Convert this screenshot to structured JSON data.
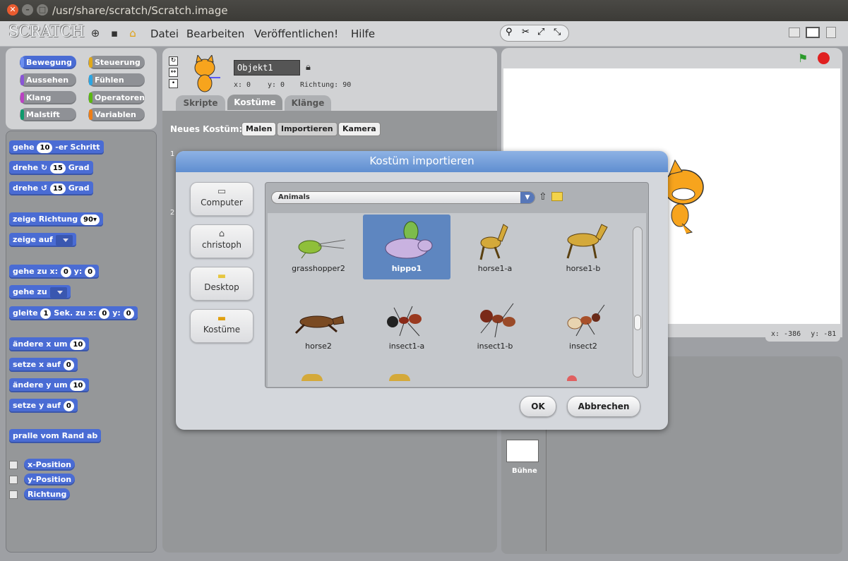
{
  "window": {
    "title": "/usr/share/scratch/Scratch.image"
  },
  "menu": {
    "logo": "SCRATCH",
    "items": [
      "Datei",
      "Bearbeiten",
      "Veröffentlichen!",
      "Hilfe"
    ]
  },
  "categories": [
    {
      "label": "Bewegung",
      "color": "#4a6cd4"
    },
    {
      "label": "Steuerung",
      "color": "#e1a91a"
    },
    {
      "label": "Aussehen",
      "color": "#8a55d7"
    },
    {
      "label": "Fühlen",
      "color": "#2ca5e2"
    },
    {
      "label": "Klang",
      "color": "#bb42c3"
    },
    {
      "label": "Operatoren",
      "color": "#5cb712"
    },
    {
      "label": "Malstift",
      "color": "#0e9a6c"
    },
    {
      "label": "Variablen",
      "color": "#ee7d16"
    }
  ],
  "blocks": {
    "move": {
      "a": "gehe",
      "v": "10",
      "b": "-er Schritt"
    },
    "turn_right": {
      "a": "drehe",
      "v": "15",
      "b": "Grad"
    },
    "turn_left": {
      "a": "drehe",
      "v": "15",
      "b": "Grad"
    },
    "point_dir": {
      "a": "zeige Richtung",
      "v": "90"
    },
    "point_to": {
      "a": "zeige auf"
    },
    "goto_xy": {
      "a": "gehe zu x:",
      "x": "0",
      "b": "y:",
      "y": "0"
    },
    "goto": {
      "a": "gehe zu"
    },
    "glide": {
      "a": "gleite",
      "v": "1",
      "b": "Sek. zu x:",
      "x": "0",
      "c": "y:",
      "y": "0"
    },
    "change_x": {
      "a": "ändere x um",
      "v": "10"
    },
    "set_x": {
      "a": "setze x auf",
      "v": "0"
    },
    "change_y": {
      "a": "ändere y um",
      "v": "10"
    },
    "set_y": {
      "a": "setze y auf",
      "v": "0"
    },
    "bounce": {
      "a": "pralle vom Rand ab"
    },
    "rep_x": "x-Position",
    "rep_y": "y-Position",
    "rep_dir": "Richtung"
  },
  "sprite": {
    "name": "Objekt1",
    "x": "x: 0",
    "y": "y: 0",
    "direction": "Richtung: 90"
  },
  "tabs": [
    "Skripte",
    "Kostüme",
    "Klänge"
  ],
  "costumes": {
    "label": "Neues Kostüm:",
    "buttons": [
      "Malen",
      "Importieren",
      "Kamera"
    ],
    "num1": "1",
    "num2": "2"
  },
  "stage": {
    "coords_x": "x: -386",
    "coords_y": "y: -81",
    "stage_label": "Bühne"
  },
  "dialog": {
    "title": "Kostüm importieren",
    "places": [
      {
        "label": "Computer",
        "icon": "computer-icon"
      },
      {
        "label": "christoph",
        "icon": "home-icon"
      },
      {
        "label": "Desktop",
        "icon": "folder-icon"
      },
      {
        "label": "Kostüme",
        "icon": "costumes-folder-icon"
      }
    ],
    "folder": "Animals",
    "files": [
      {
        "name": "grasshopper2",
        "selected": false,
        "icon": "grasshopper"
      },
      {
        "name": "hippo1",
        "selected": true,
        "icon": "hippo"
      },
      {
        "name": "horse1-a",
        "selected": false,
        "icon": "horse"
      },
      {
        "name": "horse1-b",
        "selected": false,
        "icon": "horse"
      },
      {
        "name": "horse2",
        "selected": false,
        "icon": "horse"
      },
      {
        "name": "insect1-a",
        "selected": false,
        "icon": "ant"
      },
      {
        "name": "insect1-b",
        "selected": false,
        "icon": "ant"
      },
      {
        "name": "insect2",
        "selected": false,
        "icon": "ant"
      }
    ],
    "ok": "OK",
    "cancel": "Abbrechen"
  }
}
